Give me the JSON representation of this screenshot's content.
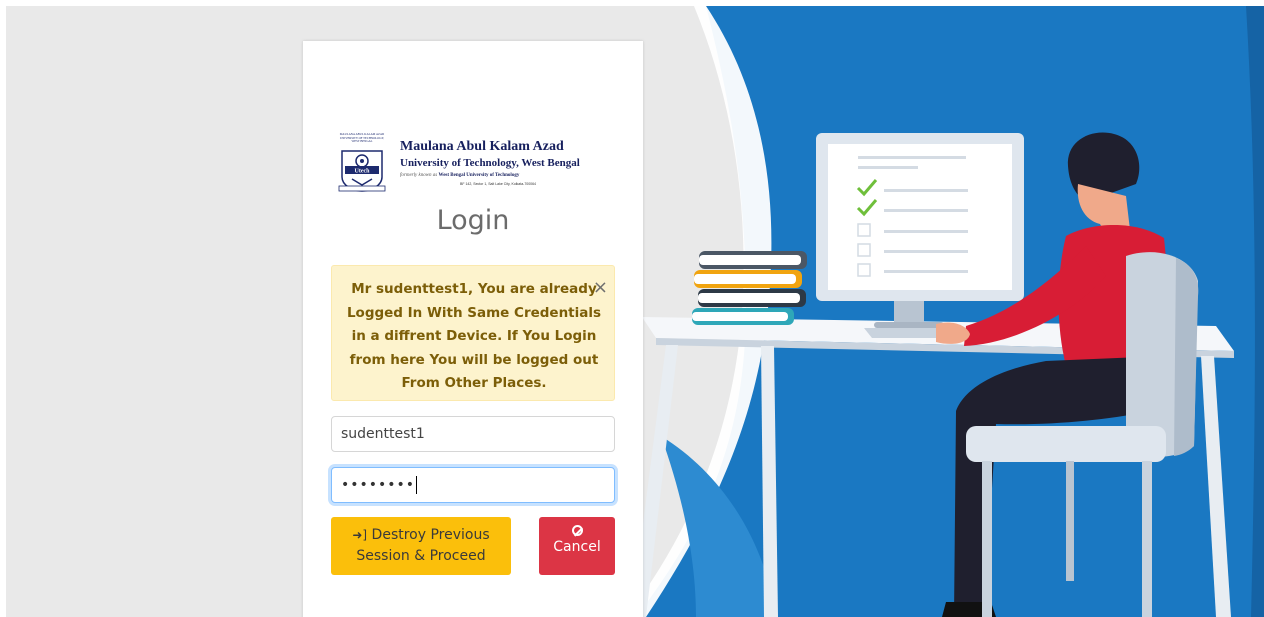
{
  "university": {
    "line1": "Maulana Abul Kalam Azad",
    "line2": "University of Technology, West Bengal",
    "formerly_prefix": "formerly known as",
    "formerly_name": "West Bengal University of Technology",
    "address": "BF 142, Sector 1, Salt Lake City, Kolkata-700064",
    "emblem_text": "MAULANA ABUL KALAM AZAD UNIVERSITY OF TECHNOLOGY, WEST BENGAL",
    "emblem_label": "Utech"
  },
  "login": {
    "title": "Login"
  },
  "alert": {
    "message": "Mr sudenttest1, You are already Logged In With Same Credentials in a diffrent Device. If You Login from here You will be logged out From Other Places.",
    "close_glyph": "×"
  },
  "form": {
    "username_value": "sudenttest1",
    "password_mask": "••••••••"
  },
  "buttons": {
    "destroy_icon": "➜]",
    "destroy_label": "Destroy Previous Session & Proceed",
    "cancel_label": "Cancel"
  },
  "icons": {
    "destroy": "sign-in-icon",
    "cancel": "ban-icon",
    "close": "close-icon"
  },
  "colors": {
    "background": "#e9e9e9",
    "illustration_blue": "#1a78c2",
    "alert_bg": "#fdf3cd",
    "alert_text": "#7c5e08",
    "warning_button": "#fbbf0b",
    "danger_button": "#dc3545"
  }
}
